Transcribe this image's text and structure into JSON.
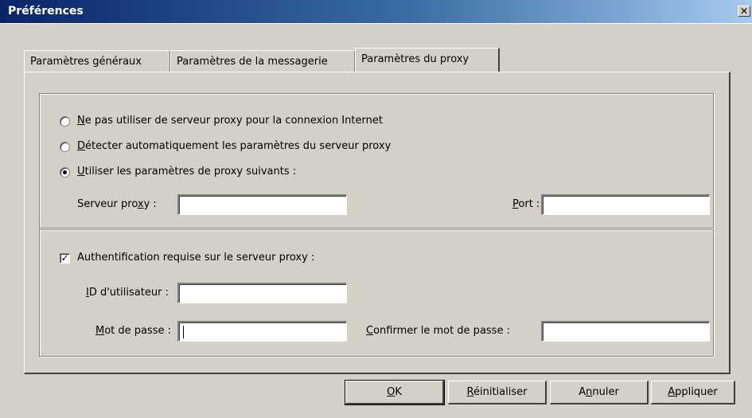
{
  "window": {
    "title": "Préférences",
    "close_glyph": "✕"
  },
  "tabs": [
    {
      "label": "Paramètres généraux",
      "active": false
    },
    {
      "label": "Paramètres de la messagerie",
      "active": false
    },
    {
      "label": "Paramètres du proxy",
      "active": true
    }
  ],
  "proxy_mode": {
    "options": [
      {
        "key": "N",
        "rest": "e pas utiliser de serveur proxy pour la connexion Internet",
        "selected": false
      },
      {
        "key": "D",
        "rest": "étecter automatiquement les paramètres du serveur proxy",
        "selected": false
      },
      {
        "key": "U",
        "rest": "tiliser les paramètres de proxy suivants :",
        "selected": true
      }
    ],
    "server_label_pre": "Serveur pro",
    "server_label_key": "x",
    "server_label_post": "y :",
    "server_value": "",
    "port_label_key": "P",
    "port_label_post": "ort :",
    "port_value": ""
  },
  "auth": {
    "checkbox_label": "Authentification requise sur le serveur proxy :",
    "checked": true,
    "check_glyph": "✓",
    "userid_label_key": "I",
    "userid_label_post": "D d'utilisateur :",
    "userid_value": "",
    "password_label_key": "M",
    "password_label_post": "ot de passe :",
    "password_value": "",
    "confirm_label_key": "C",
    "confirm_label_post": "onfirmer le mot de passe :",
    "confirm_value": ""
  },
  "buttons": {
    "ok_key": "O",
    "ok_post": "K",
    "reset_key": "R",
    "reset_post": "éinitialiser",
    "cancel_pre": "A",
    "cancel_key": "n",
    "cancel_post": "nuler",
    "apply_key": "A",
    "apply_post": "ppliquer"
  }
}
